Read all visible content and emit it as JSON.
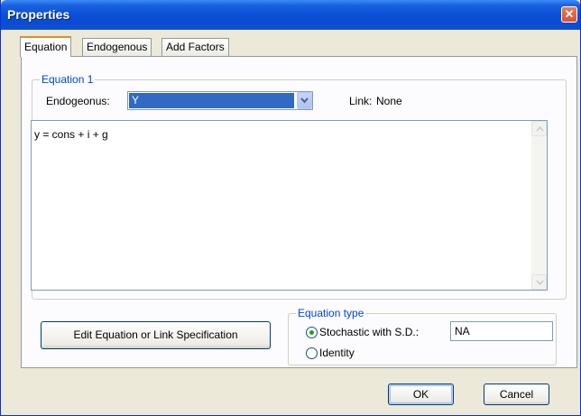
{
  "window": {
    "title": "Properties"
  },
  "tabs": [
    {
      "label": "Equation",
      "active": true
    },
    {
      "label": "Endogenous",
      "active": false
    },
    {
      "label": "Add Factors",
      "active": false
    }
  ],
  "equation_group": {
    "legend": "Equation 1",
    "endogenous_label": "Endogeonus:",
    "endogenous_value": "Y",
    "link_label": "Link:",
    "link_value": "None",
    "equation_text": "y = cons + i + g"
  },
  "edit_button_label": "Edit Equation or Link Specification",
  "equation_type": {
    "legend": "Equation type",
    "options": [
      {
        "label": "Stochastic with S.D.:",
        "selected": true
      },
      {
        "label": "Identity",
        "selected": false
      }
    ],
    "sd_value": "NA"
  },
  "buttons": {
    "ok": "OK",
    "cancel": "Cancel"
  },
  "colors": {
    "title_bar": "#0a4fd6",
    "selection": "#316ac5",
    "legend_text": "#0046d5",
    "active_tab_accent": "#e68b2c"
  },
  "icons": {
    "close": "close-icon",
    "dropdown": "chevron-down-icon",
    "scroll_up": "arrow-up-icon",
    "scroll_down": "arrow-down-icon"
  }
}
